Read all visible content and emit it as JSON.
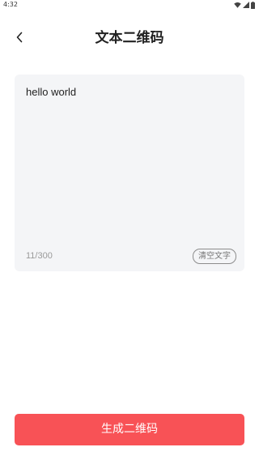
{
  "status_bar": {
    "time": "4:32",
    "icons": [
      "wifi-icon",
      "signal-icon",
      "battery-icon"
    ]
  },
  "header": {
    "back_icon": "chevron-left-icon",
    "title": "文本二维码"
  },
  "editor": {
    "text_value": "hello world",
    "char_count": "11/300",
    "clear_label": "清空文字",
    "background_color": "#f4f5f7"
  },
  "footer": {
    "generate_label": "生成二维码",
    "button_color": "#f85256"
  }
}
